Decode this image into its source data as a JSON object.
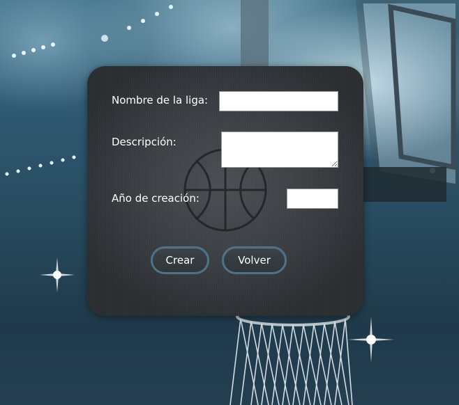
{
  "form": {
    "name_label": "Nombre de la liga:",
    "name_value": "",
    "description_label": "Descripción:",
    "description_value": "",
    "year_label": "Año de creación:",
    "year_value": ""
  },
  "actions": {
    "create_label": "Crear",
    "back_label": "Volver"
  },
  "colors": {
    "panel": "#3a3e42",
    "button_border": "#4f7287",
    "text": "#ffffff"
  },
  "icons": {
    "panel_watermark": "basketball-icon"
  }
}
